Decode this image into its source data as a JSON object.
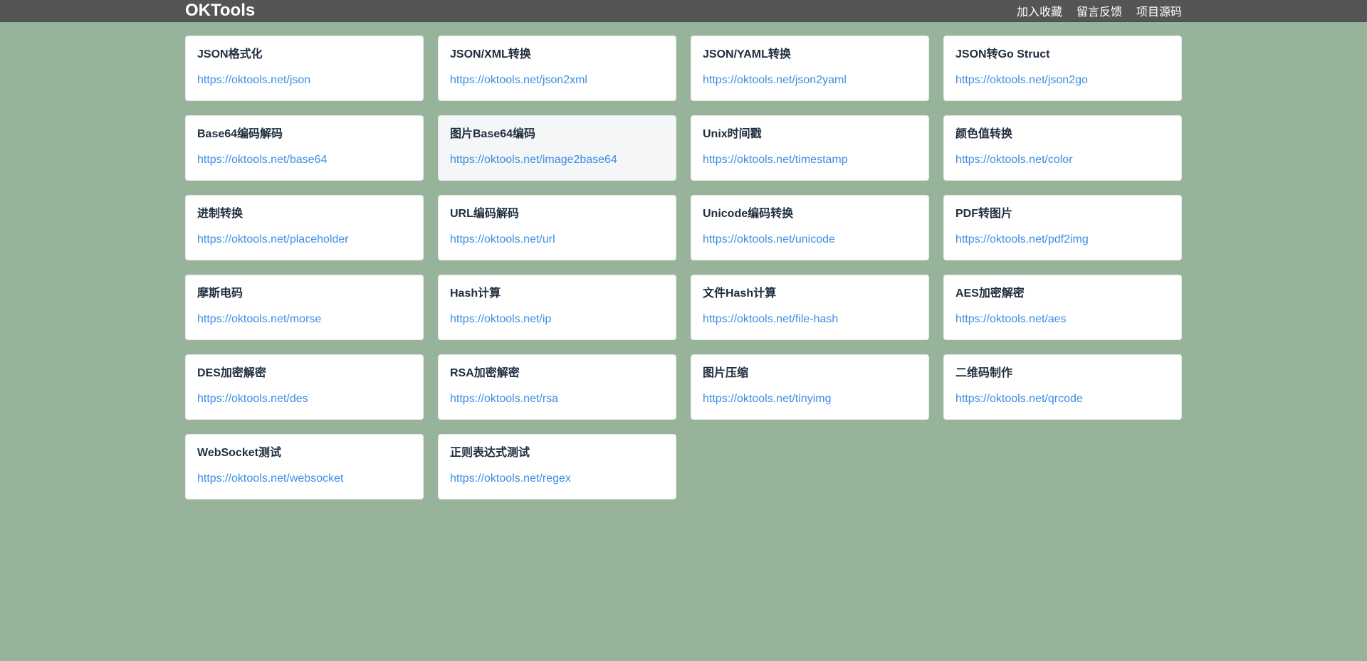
{
  "header": {
    "brand": "OKTools",
    "nav": [
      {
        "label": "加入收藏"
      },
      {
        "label": "留言反馈"
      },
      {
        "label": "项目源码"
      }
    ]
  },
  "tools": [
    {
      "title": "JSON格式化",
      "url": "https://oktools.net/json"
    },
    {
      "title": "JSON/XML转换",
      "url": "https://oktools.net/json2xml"
    },
    {
      "title": "JSON/YAML转换",
      "url": "https://oktools.net/json2yaml"
    },
    {
      "title": "JSON转Go Struct",
      "url": "https://oktools.net/json2go"
    },
    {
      "title": "Base64编码解码",
      "url": "https://oktools.net/base64"
    },
    {
      "title": "图片Base64编码",
      "url": "https://oktools.net/image2base64"
    },
    {
      "title": "Unix时间戳",
      "url": "https://oktools.net/timestamp"
    },
    {
      "title": "颜色值转换",
      "url": "https://oktools.net/color"
    },
    {
      "title": "进制转换",
      "url": "https://oktools.net/placeholder"
    },
    {
      "title": "URL编码解码",
      "url": "https://oktools.net/url"
    },
    {
      "title": "Unicode编码转换",
      "url": "https://oktools.net/unicode"
    },
    {
      "title": "PDF转图片",
      "url": "https://oktools.net/pdf2img"
    },
    {
      "title": "摩斯电码",
      "url": "https://oktools.net/morse"
    },
    {
      "title": "Hash计算",
      "url": "https://oktools.net/ip"
    },
    {
      "title": "文件Hash计算",
      "url": "https://oktools.net/file-hash"
    },
    {
      "title": "AES加密解密",
      "url": "https://oktools.net/aes"
    },
    {
      "title": "DES加密解密",
      "url": "https://oktools.net/des"
    },
    {
      "title": "RSA加密解密",
      "url": "https://oktools.net/rsa"
    },
    {
      "title": "图片压缩",
      "url": "https://oktools.net/tinyimg"
    },
    {
      "title": "二维码制作",
      "url": "https://oktools.net/qrcode"
    },
    {
      "title": "WebSocket测试",
      "url": "https://oktools.net/websocket"
    },
    {
      "title": "正则表达式测试",
      "url": "https://oktools.net/regex"
    }
  ],
  "colors": {
    "background": "#97b49b",
    "topbar": "#555555",
    "link": "#3a8ee6",
    "title": "#1f2d3d",
    "hover_card": "#f4f6f8"
  },
  "hovered_card_index": 5
}
